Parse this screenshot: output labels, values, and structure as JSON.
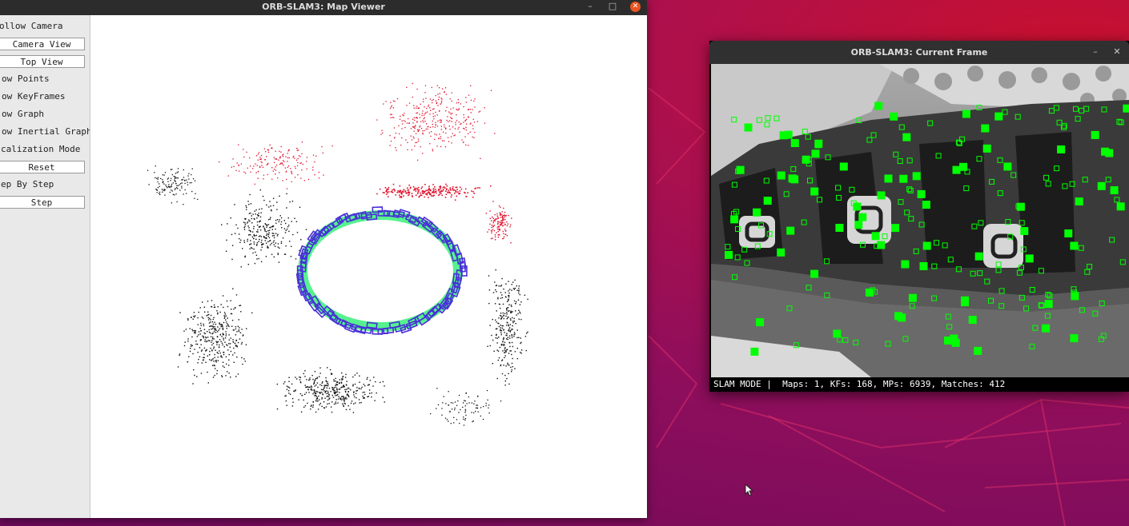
{
  "map_viewer": {
    "title": "ORB-SLAM3: Map Viewer",
    "minimize": "–",
    "maximize": "□",
    "close": "✕",
    "panel": {
      "follow_camera": "ollow Camera",
      "camera_view": "Camera View",
      "top_view": "Top View",
      "show_points": "ow Points",
      "show_keyframes": "ow KeyFrames",
      "show_graph": "ow Graph",
      "show_inertial": "ow Inertial Graph",
      "localization_mode": "calization Mode",
      "reset": "Reset",
      "step_by_step": "ep By Step",
      "step": "Step"
    }
  },
  "current_frame": {
    "title": "ORB-SLAM3: Current Frame",
    "minimize": "–",
    "close": "✕",
    "status": "SLAM MODE |  Maps: 1, KFs: 168, MPs: 6939, Matches: 412"
  },
  "colors": {
    "map_points_black": "#111111",
    "map_points_red": "#e0102a",
    "keyframes": "#4a2fd8",
    "graph_green": "#38f07a",
    "feature_green": "#00ff00"
  }
}
